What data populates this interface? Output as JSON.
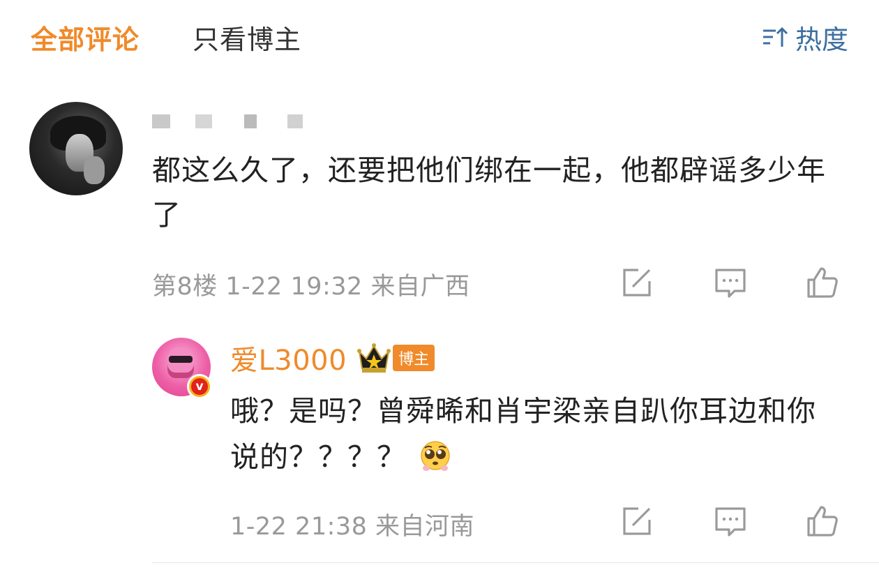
{
  "header": {
    "tabs": [
      {
        "label": "全部评论",
        "active": true
      },
      {
        "label": "只看博主",
        "active": false
      }
    ],
    "sort_label": "热度",
    "sort_icon": "sort-icon"
  },
  "colors": {
    "accent": "#f08a2a",
    "link_blue": "#3d6fa0",
    "meta_gray": "#999999",
    "text": "#222222"
  },
  "comment": {
    "username_redacted": true,
    "text": "都这么久了，还要把他们绑在一起，他都辟谣多少年了",
    "meta": "第8楼 1-22 19:32 来自广西",
    "actions": [
      "share-icon",
      "comment-icon",
      "like-icon"
    ]
  },
  "reply": {
    "username": "爱L3000",
    "badge": "博主",
    "verified_icon": "v",
    "text": "哦？是吗？曾舜晞和肖宇梁亲自趴你耳边和你说的？？？？",
    "emoji": "pleading-face-icon",
    "meta": "1-22 21:38 来自河南",
    "actions": [
      "share-icon",
      "comment-icon",
      "like-icon"
    ]
  }
}
